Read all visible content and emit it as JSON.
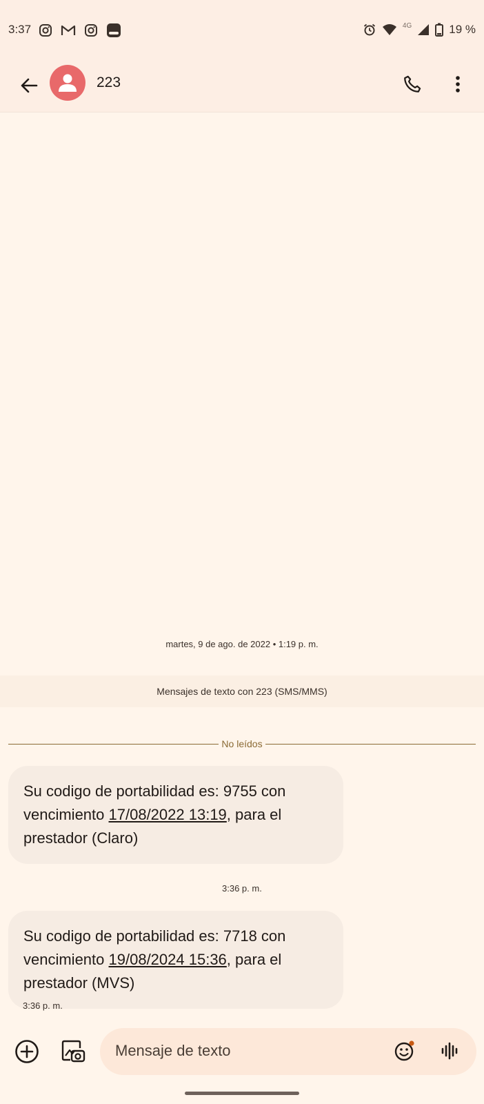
{
  "status_bar": {
    "time": "3:37",
    "network": "4G",
    "battery": "19 %",
    "app_icons": [
      "instagram-icon",
      "gmail-icon",
      "instagram-icon",
      "app-icon"
    ]
  },
  "header": {
    "contact_name": "223",
    "avatar_color": "#e8696a"
  },
  "conversation": {
    "date_header": "martes, 9 de ago. de 2022 • 1:19 p. m.",
    "sms_banner": "Mensajes de texto con 223 (SMS/MMS)",
    "unread_label": "No leídos",
    "messages": [
      {
        "text_before": "Su codigo de portabilidad es: 9755 con vencimiento ",
        "link": "17/08/2022 13:19",
        "text_after": ", para el prestador (Claro)",
        "time": "3:36 p. m."
      },
      {
        "text_before": "Su codigo de portabilidad es: 7718 con vencimiento ",
        "link": "19/08/2024 15:36",
        "text_after": ", para el prestador (MVS)",
        "time": "3:36 p. m."
      }
    ]
  },
  "compose": {
    "placeholder": "Mensaje de texto"
  },
  "colors": {
    "background": "#fff5eb",
    "bar": "#fdeee4",
    "accent": "#8a6a34",
    "bubble": "#f6ece3"
  }
}
